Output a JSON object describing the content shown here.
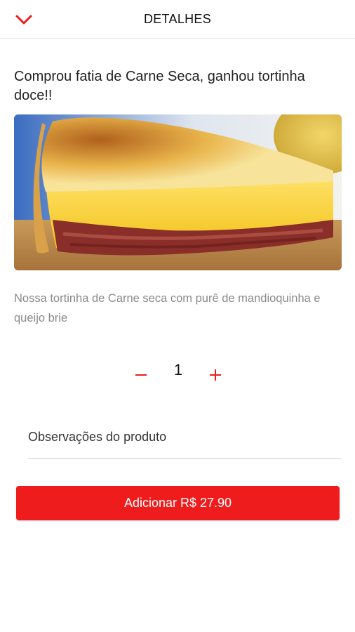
{
  "header": {
    "title": "DETALHES",
    "back_icon": "chevron-down-icon"
  },
  "product": {
    "title": "Comprou fatia de Carne Seca, ganhou tortinha doce!!",
    "description": "Nossa tortinha de Carne seca com purê de mandioquinha e queijo brie"
  },
  "quantity": {
    "value": "1",
    "minus_icon": "minus-icon",
    "plus_icon": "plus-icon"
  },
  "notes": {
    "placeholder": "Observações do produto",
    "value": ""
  },
  "add_button": {
    "label": "Adicionar R$ 27.90"
  },
  "colors": {
    "accent": "#ee1c1c",
    "text_primary": "#222222",
    "text_muted": "#8a8a8a",
    "divider": "#e6e6e6"
  }
}
